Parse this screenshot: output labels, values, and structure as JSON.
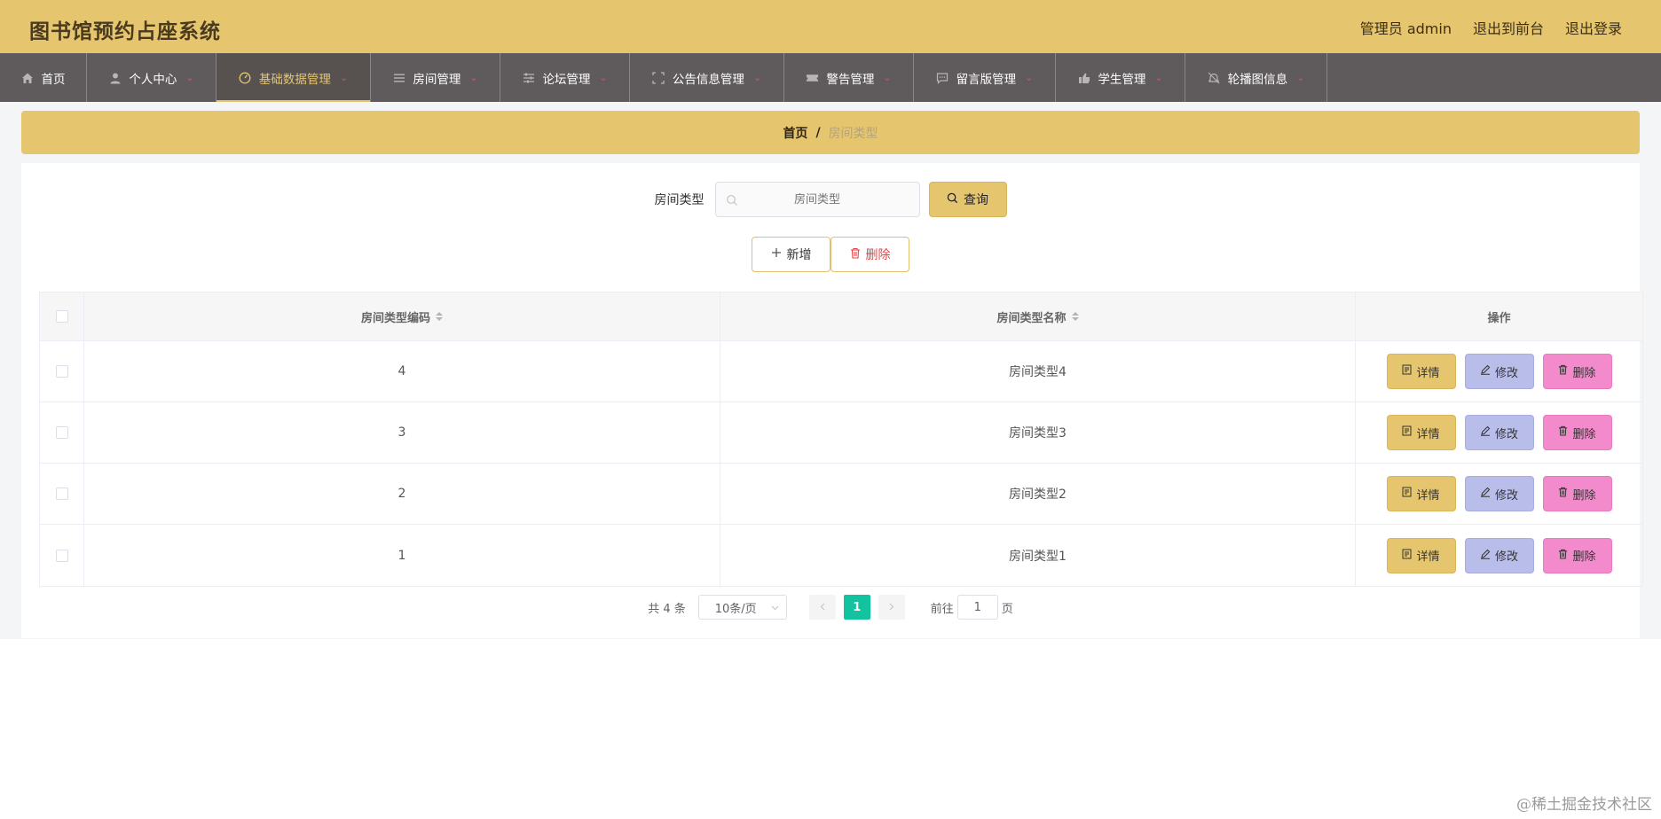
{
  "app": {
    "title": "图书馆预约占座系统"
  },
  "header": {
    "user": "管理员 admin",
    "to_front": "退出到前台",
    "logout": "退出登录"
  },
  "nav": [
    {
      "label": "首页",
      "icon": "home-icon"
    },
    {
      "label": "个人中心",
      "icon": "user-icon"
    },
    {
      "label": "基础数据管理",
      "icon": "dashboard-icon",
      "active": true
    },
    {
      "label": "房间管理",
      "icon": "list-icon"
    },
    {
      "label": "论坛管理",
      "icon": "sliders-icon"
    },
    {
      "label": "公告信息管理",
      "icon": "frame-icon"
    },
    {
      "label": "警告管理",
      "icon": "ticket-icon"
    },
    {
      "label": "留言版管理",
      "icon": "chat-icon"
    },
    {
      "label": "学生管理",
      "icon": "thumb-icon"
    },
    {
      "label": "轮播图信息",
      "icon": "bell-off-icon"
    }
  ],
  "breadcrumb": {
    "home": "首页",
    "sep": "/",
    "current": "房间类型"
  },
  "search": {
    "label": "房间类型",
    "placeholder": "房间类型",
    "button": "查询"
  },
  "actions": {
    "add": "新增",
    "delete": "删除"
  },
  "table": {
    "headers": {
      "code": "房间类型编码",
      "name": "房间类型名称",
      "ops": "操作"
    },
    "rows": [
      {
        "code": "4",
        "name": "房间类型4"
      },
      {
        "code": "3",
        "name": "房间类型3"
      },
      {
        "code": "2",
        "name": "房间类型2"
      },
      {
        "code": "1",
        "name": "房间类型1"
      }
    ],
    "op_labels": {
      "detail": "详情",
      "edit": "修改",
      "delete": "删除"
    }
  },
  "pagination": {
    "total": "共 4 条",
    "page_size": "10条/页",
    "current_page": "1",
    "goto_prefix": "前往",
    "goto_value": "1",
    "goto_suffix": "页"
  },
  "watermark": "@稀土掘金技术社区",
  "colors": {
    "header_bg": "#e6c56f",
    "nav_bg": "#5f5a5c",
    "active_page": "#13c29e",
    "edit_btn": "#b9bdea",
    "delete_btn": "#f38acb"
  }
}
